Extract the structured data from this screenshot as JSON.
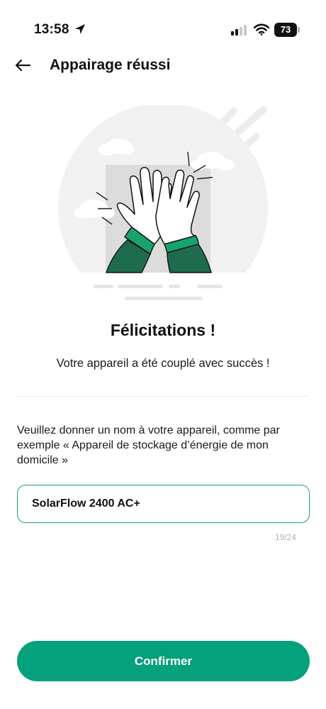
{
  "status_bar": {
    "time": "13:58",
    "battery": "73",
    "icons": [
      "location-arrow-icon",
      "cellular-signal-icon",
      "wifi-icon",
      "battery-icon"
    ]
  },
  "header": {
    "back_icon": "arrow-left-icon",
    "title": "Appairage réussi"
  },
  "illustration": {
    "subject": "high-five-hands-illustration",
    "colors": {
      "circle": "#f1f1f1",
      "square": "#dcdcdc",
      "sleeve": "#1f6b4f",
      "cuff": "#18a36e"
    }
  },
  "main": {
    "title": "Félicitations !",
    "message": "Votre appareil a été couplé avec succès !",
    "prompt": "Veuillez donner un nom à votre appareil, comme par exemple « Appareil de stockage d’énergie de mon domicile »",
    "name_input": {
      "value": "SolarFlow 2400 AC+"
    },
    "counter": "19/24"
  },
  "footer": {
    "confirm_label": "Confirmer"
  },
  "colors": {
    "accent": "#05a07c",
    "input_border": "#1e9a78"
  }
}
